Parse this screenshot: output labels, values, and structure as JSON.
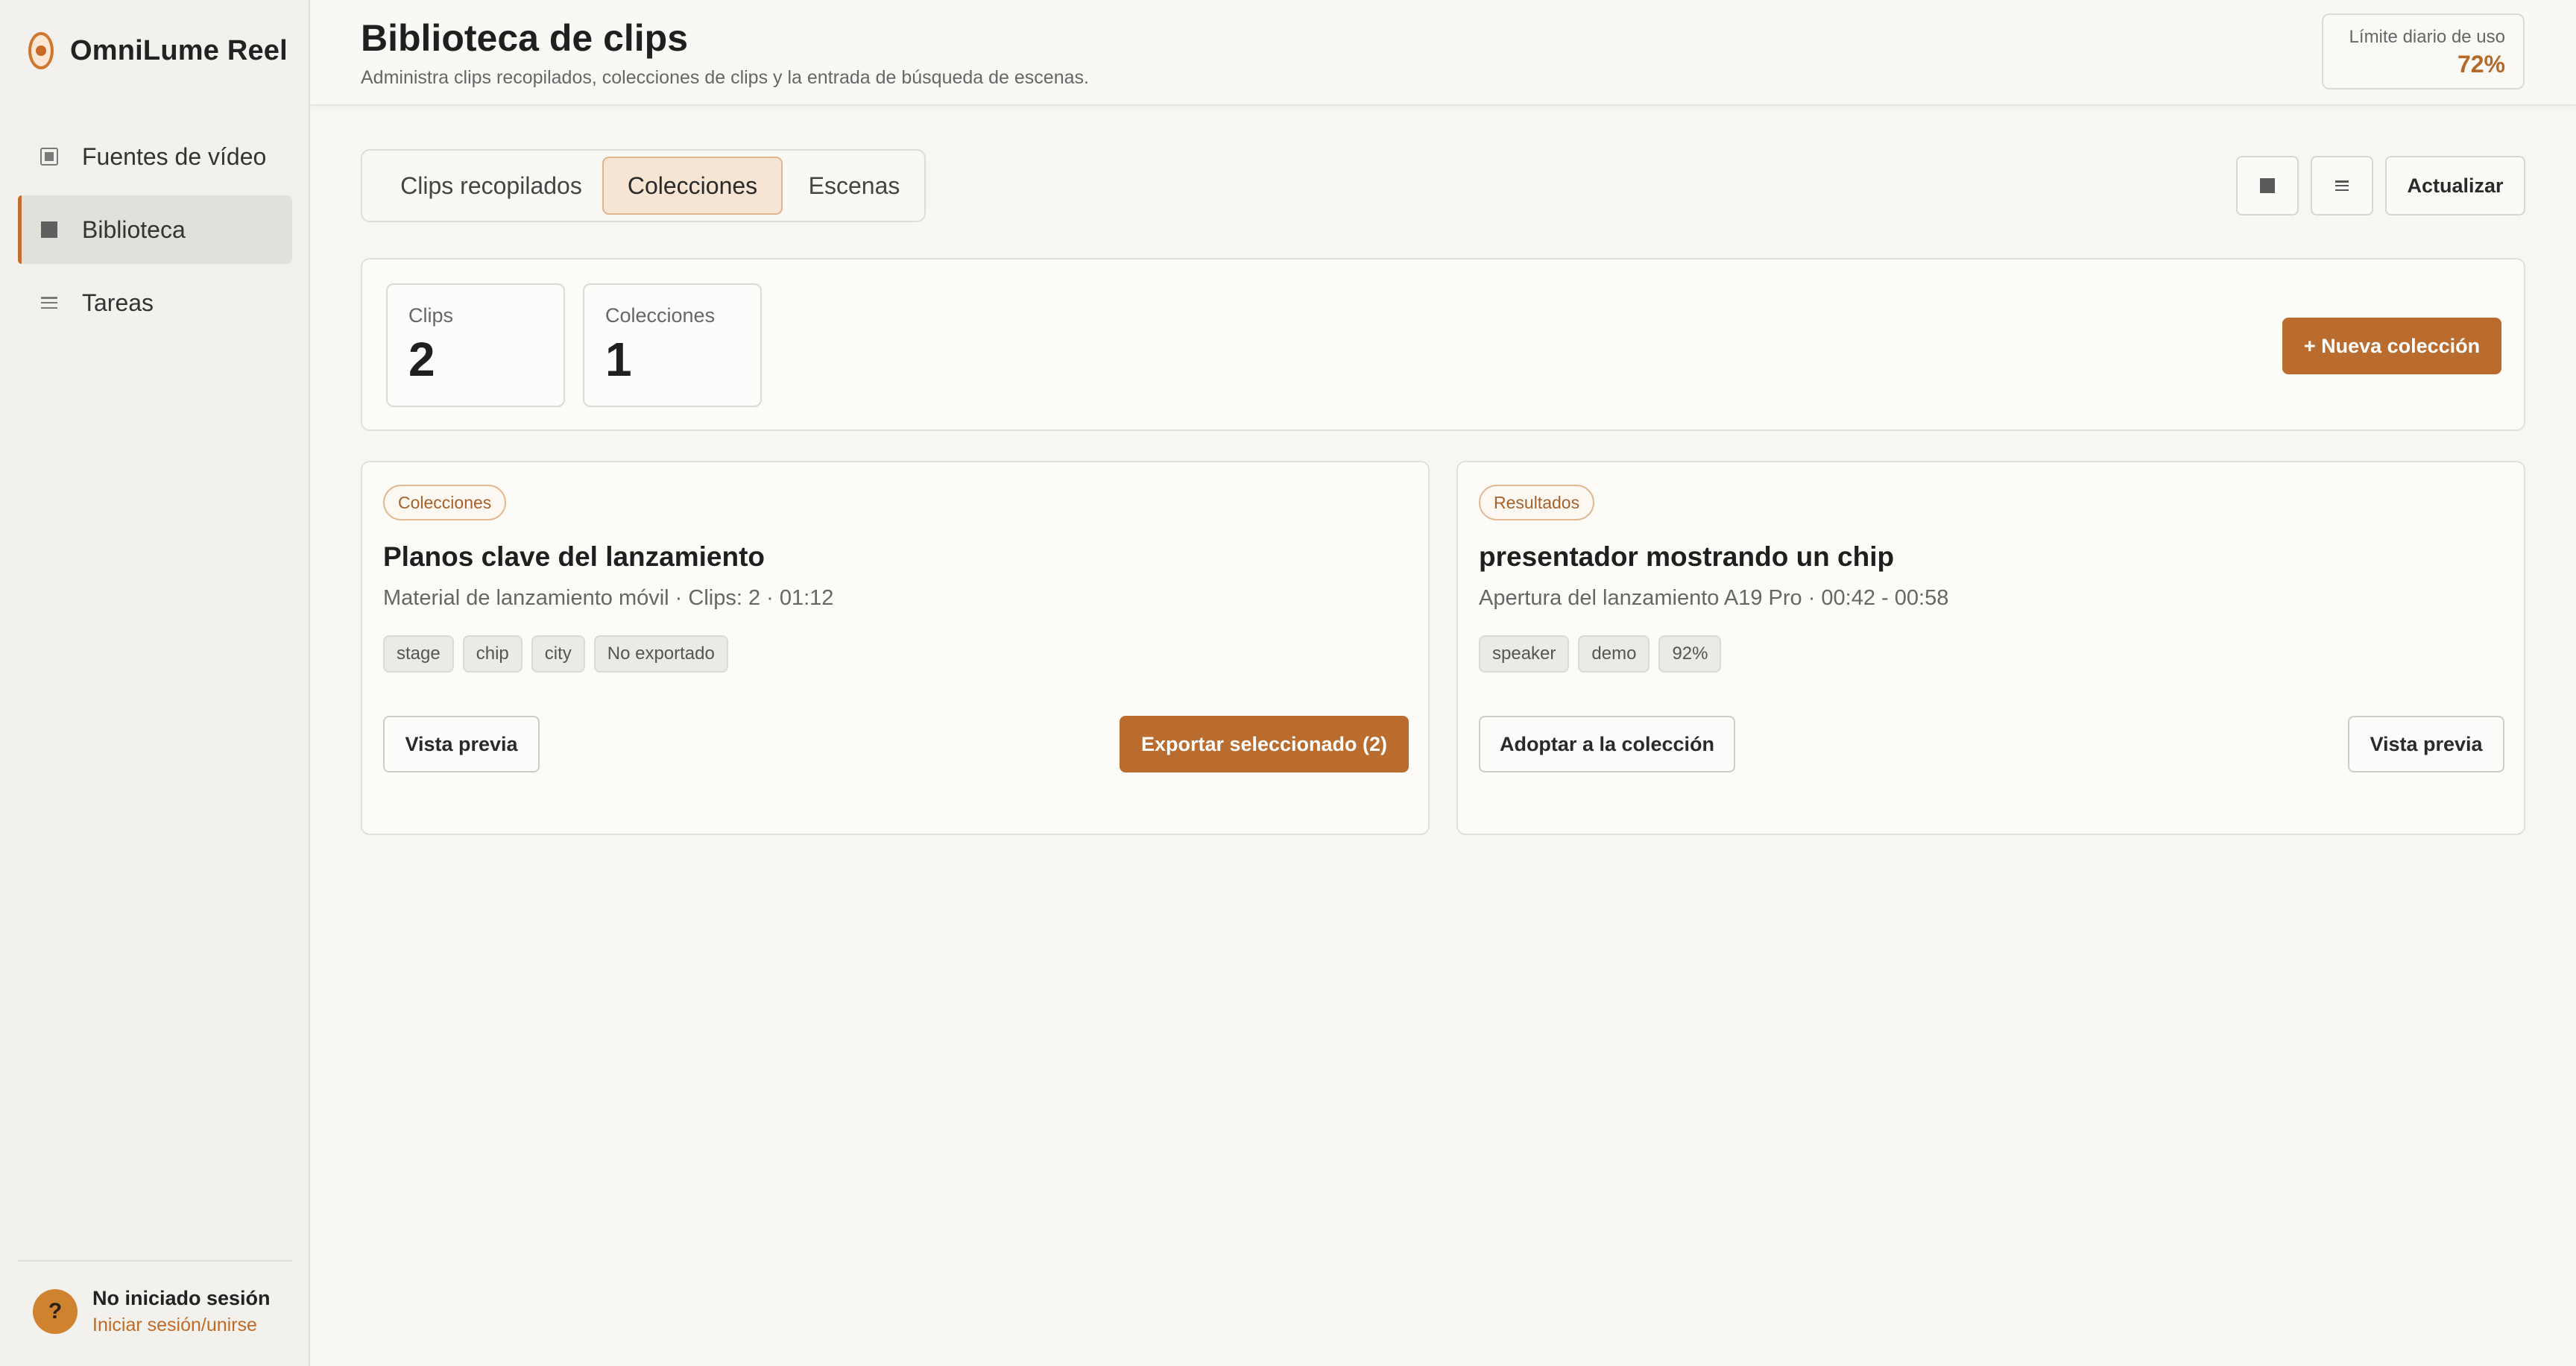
{
  "app": {
    "name": "OmniLume Reel"
  },
  "sidebar": {
    "items": [
      {
        "label": "Fuentes de vídeo",
        "icon": "film-icon",
        "active": false
      },
      {
        "label": "Biblioteca",
        "icon": "library-icon",
        "active": true
      },
      {
        "label": "Tareas",
        "icon": "list-icon",
        "active": false
      }
    ],
    "user": {
      "avatar": "?",
      "name": "No iniciado sesión",
      "link": "Iniciar sesión/unirse"
    }
  },
  "header": {
    "title": "Biblioteca de clips",
    "subtitle": "Administra clips recopilados, colecciones de clips y la entrada de búsqueda de escenas.",
    "quota": {
      "label": "Límite diario de uso",
      "value": "72%"
    }
  },
  "tabs": [
    {
      "label": "Clips recopilados",
      "active": false
    },
    {
      "label": "Colecciones",
      "active": true
    },
    {
      "label": "Escenas",
      "active": false
    }
  ],
  "toolbar": {
    "grid_icon": "grid-view-icon",
    "list_icon": "list-view-icon",
    "refresh_label": "Actualizar"
  },
  "stats": [
    {
      "label": "Clips",
      "value": "2"
    },
    {
      "label": "Colecciones",
      "value": "1"
    }
  ],
  "new_collection_label": "+ Nueva colección",
  "cards": [
    {
      "badge": "Colecciones",
      "title": "Planos clave del lanzamiento",
      "meta": "Material de lanzamiento móvil · Clips: 2 · 01:12",
      "tags": [
        "stage",
        "chip",
        "city",
        "No exportado"
      ],
      "left_button": "Vista previa",
      "right_button": "Exportar seleccionado (2)"
    },
    {
      "badge": "Resultados",
      "title": "presentador mostrando un chip",
      "meta": "Apertura del lanzamiento A19 Pro · 00:42 - 00:58",
      "tags": [
        "speaker",
        "demo",
        "92%"
      ],
      "left_button": "Adoptar a la colección",
      "right_button": "Vista previa"
    }
  ],
  "colors": {
    "accent": "#b96c2e",
    "accent_light": "#f6e5d5",
    "background": "#f7f6f2",
    "sidebar": "#f2f1ed"
  }
}
